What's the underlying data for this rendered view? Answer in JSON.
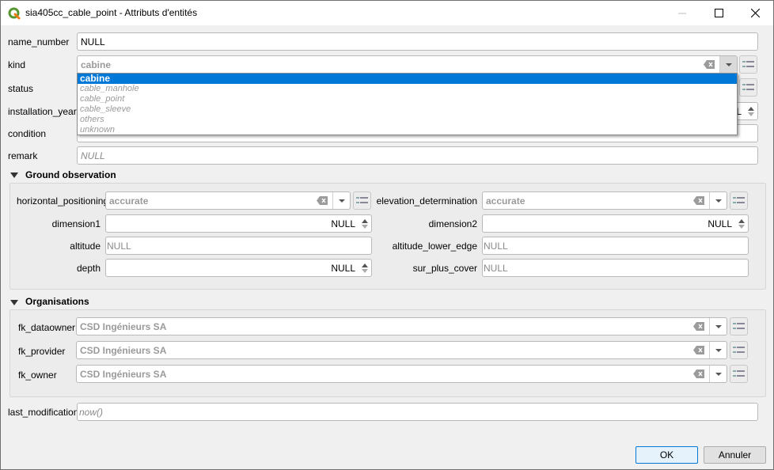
{
  "window": {
    "title": "sia405cc_cable_point - Attributs d'entités",
    "icons": {
      "app": "qgis-logo-icon",
      "minimize": "minimize-icon",
      "maximize": "maximize-icon",
      "close": "close-icon"
    }
  },
  "form": {
    "name_number": {
      "label": "name_number",
      "value": "NULL"
    },
    "kind": {
      "label": "kind",
      "value": "cabine",
      "dropdown_open": true,
      "options": [
        "cabine",
        "cable_manhole",
        "cable_point",
        "cable_sleeve",
        "others",
        "unknown"
      ],
      "selected_index": 0
    },
    "status": {
      "label": "status"
    },
    "installation_year": {
      "label": "installation_year",
      "value_partial": "L"
    },
    "condition": {
      "label": "condition"
    },
    "remark": {
      "label": "remark",
      "placeholder": "NULL"
    },
    "ground_observation": {
      "title": "Ground observation",
      "horizontal_positioning": {
        "label": "horizontal_positioning",
        "value": "accurate"
      },
      "elevation_determination": {
        "label": "elevation_determination",
        "value": "accurate"
      },
      "dimension1": {
        "label": "dimension1",
        "value": "NULL"
      },
      "dimension2": {
        "label": "dimension2",
        "value": "NULL"
      },
      "altitude": {
        "label": "altitude",
        "placeholder": "NULL"
      },
      "altitude_lower_edge": {
        "label": "altitude_lower_edge",
        "placeholder": "NULL"
      },
      "depth": {
        "label": "depth",
        "value": "NULL"
      },
      "sur_plus_cover": {
        "label": "sur_plus_cover",
        "placeholder": "NULL"
      }
    },
    "organisations": {
      "title": "Organisations",
      "fk_dataowner": {
        "label": "fk_dataowner",
        "value": "CSD Ingénieurs SA"
      },
      "fk_provider": {
        "label": "fk_provider",
        "value": "CSD Ingénieurs SA"
      },
      "fk_owner": {
        "label": "fk_owner",
        "value": "CSD Ingénieurs SA"
      }
    },
    "last_modification": {
      "label": "last_modification",
      "placeholder": "now()"
    }
  },
  "buttons": {
    "ok": "OK",
    "cancel": "Annuler"
  },
  "colors": {
    "selection": "#0078d7",
    "qgis_green": "#589632",
    "qgis_yellow": "#ee7913"
  }
}
